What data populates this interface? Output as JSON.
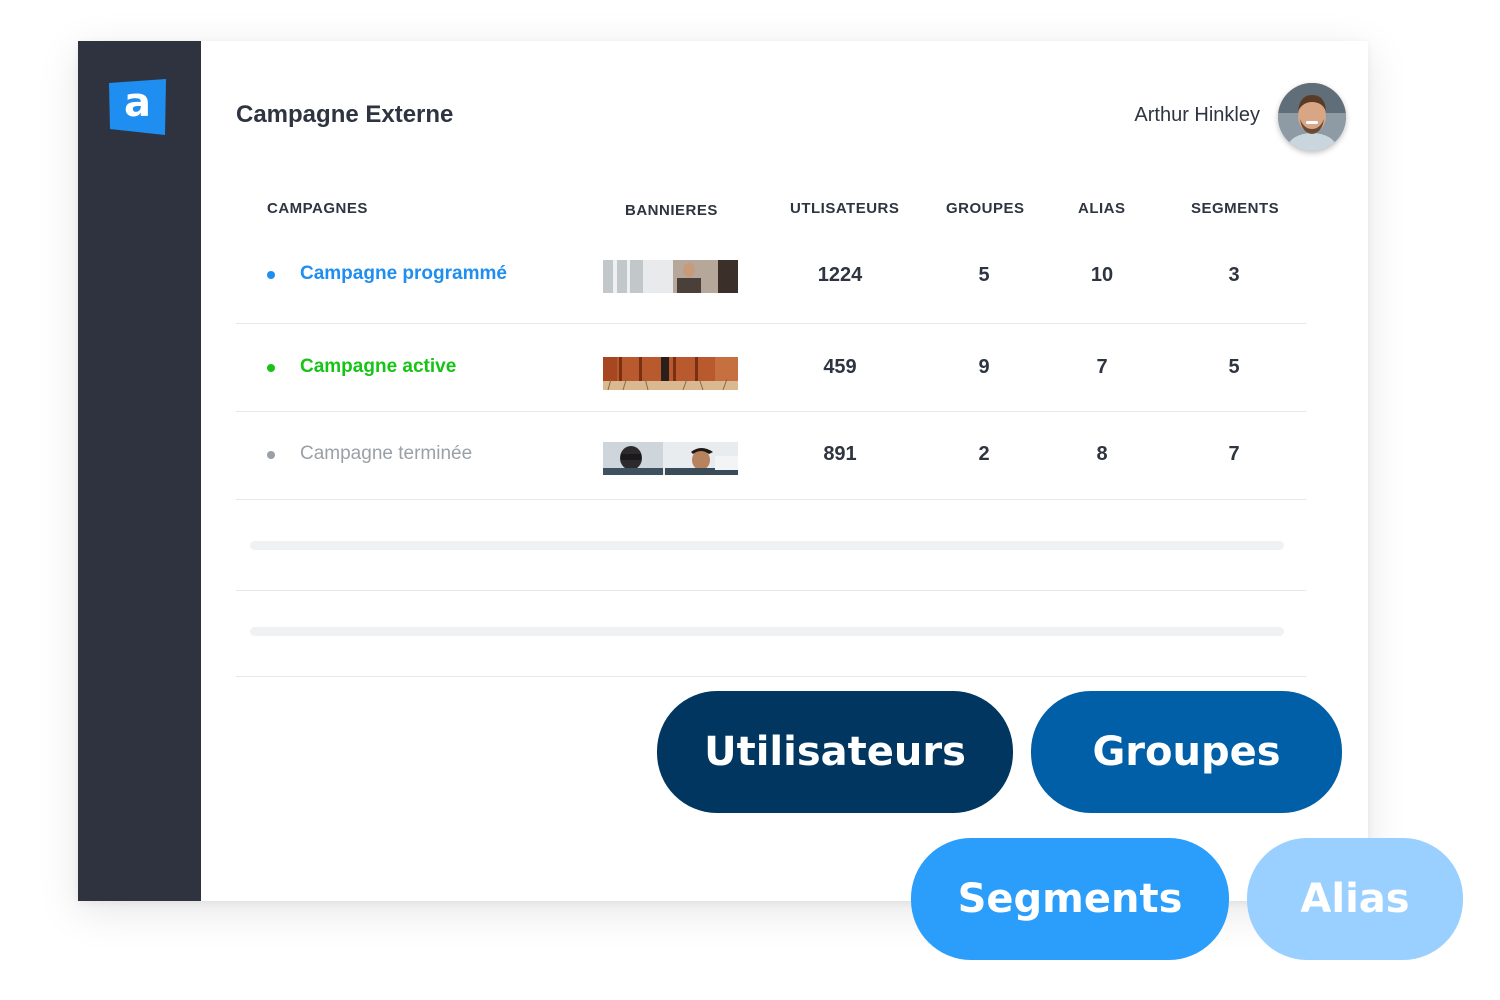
{
  "app": {
    "logo_letter": "a",
    "brand_color": "#1f8ef1"
  },
  "header": {
    "title": "Campagne Externe",
    "user_name": "Arthur Hinkley"
  },
  "table": {
    "columns": [
      "CAMPAGNES",
      "BANNIERES",
      "UTLISATEURS",
      "GROUPES",
      "ALIAS",
      "SEGMENTS"
    ],
    "rows": [
      {
        "name": "Campagne programmé",
        "status_color": "#1f8ef1",
        "utilisateurs": "1224",
        "groupes": "5",
        "alias": "10",
        "segments": "3"
      },
      {
        "name": "Campagne active",
        "status_color": "#16c416",
        "utilisateurs": "459",
        "groupes": "9",
        "alias": "7",
        "segments": "5"
      },
      {
        "name": "Campagne terminée",
        "status_color": "#9aa0a6",
        "utilisateurs": "891",
        "groupes": "2",
        "alias": "8",
        "segments": "7"
      }
    ]
  },
  "tags": {
    "utilisateurs": {
      "label": "Utilisateurs",
      "color": "#00365f"
    },
    "groupes": {
      "label": "Groupes",
      "color": "#005fa6"
    },
    "segments": {
      "label": "Segments",
      "color": "#2b9dfb"
    },
    "alias": {
      "label": "Alias",
      "color": "#99d0ff"
    }
  }
}
